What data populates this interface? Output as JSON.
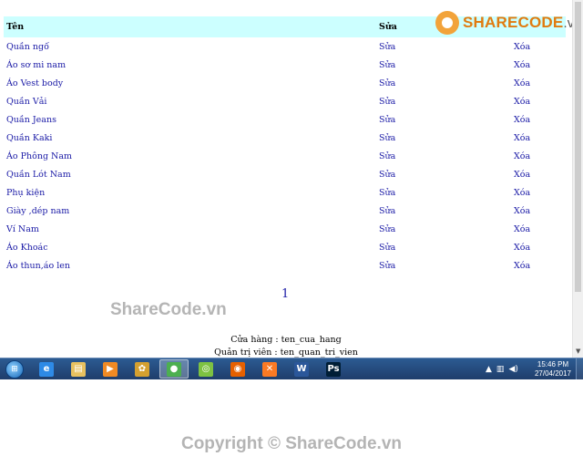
{
  "table": {
    "headers": {
      "name": "Tên",
      "edit": "Sửa",
      "delete": ""
    },
    "rows": [
      {
        "name": "Quần ngố",
        "edit": "Sửa",
        "delete": "Xóa"
      },
      {
        "name": "Áo sơ mi nam",
        "edit": "Sửa",
        "delete": "Xóa"
      },
      {
        "name": "Áo Vest body",
        "edit": "Sửa",
        "delete": "Xóa"
      },
      {
        "name": "Quần Vải",
        "edit": "Sửa",
        "delete": "Xóa"
      },
      {
        "name": "Quần Jeans",
        "edit": "Sửa",
        "delete": "Xóa"
      },
      {
        "name": "Quần Kaki",
        "edit": "Sửa",
        "delete": "Xóa"
      },
      {
        "name": "Áo Phông Nam",
        "edit": "Sửa",
        "delete": "Xóa"
      },
      {
        "name": "Quần Lót Nam",
        "edit": "Sửa",
        "delete": "Xóa"
      },
      {
        "name": "Phụ kiện",
        "edit": "Sửa",
        "delete": "Xóa"
      },
      {
        "name": "Giày ,dép nam",
        "edit": "Sửa",
        "delete": "Xóa"
      },
      {
        "name": "Ví Nam",
        "edit": "Sửa",
        "delete": "Xóa"
      },
      {
        "name": "Áo Khoác",
        "edit": "Sửa",
        "delete": "Xóa"
      },
      {
        "name": "Áo thun,áo len",
        "edit": "Sửa",
        "delete": "Xóa"
      }
    ]
  },
  "pagination": {
    "page": "1"
  },
  "footer": {
    "store": "Cửa hàng : ten_cua_hang",
    "admin": "Quản trị viên : ten_quan_tri_vien"
  },
  "watermark": {
    "logo_brand": "SHARECODE",
    "logo_domain": ".vn",
    "middle": "ShareCode.vn",
    "bottom": "Copyright © ShareCode.vn"
  },
  "taskbar": {
    "apps": [
      {
        "name": "internet-explorer",
        "glyph": "e",
        "color": "#2e8ae6"
      },
      {
        "name": "file-explorer",
        "glyph": "▤",
        "color": "#e8c160"
      },
      {
        "name": "media-player",
        "glyph": "▶",
        "color": "#f08a24"
      },
      {
        "name": "unikey",
        "glyph": "✿",
        "color": "#d4a030"
      },
      {
        "name": "chrome",
        "glyph": "●",
        "color": "#4caf50"
      },
      {
        "name": "coc-coc",
        "glyph": "◎",
        "color": "#7dc242"
      },
      {
        "name": "firefox",
        "glyph": "◉",
        "color": "#e66000"
      },
      {
        "name": "xampp",
        "glyph": "✕",
        "color": "#fb7a24"
      },
      {
        "name": "word",
        "glyph": "W",
        "color": "#2b579a"
      },
      {
        "name": "photoshop",
        "glyph": "Ps",
        "color": "#001e36"
      }
    ],
    "active_app": "chrome",
    "time": "15:46 PM",
    "date": "27/04/2017"
  }
}
